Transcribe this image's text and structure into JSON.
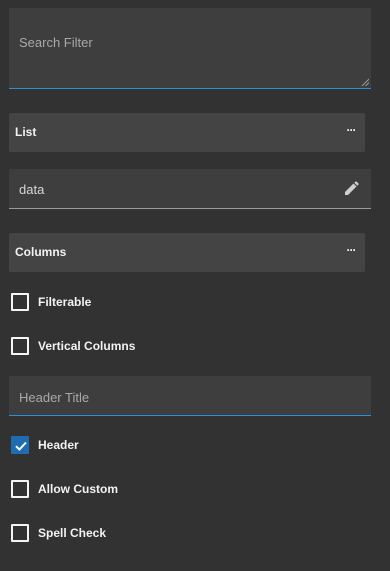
{
  "search_filter": {
    "placeholder": "Search Filter"
  },
  "list_section": {
    "label": "List",
    "more_icon": "ellipsis-icon",
    "more_glyph": "···"
  },
  "data_field": {
    "value": "data",
    "icon": "pencil-icon"
  },
  "columns_section": {
    "label": "Columns",
    "more_icon": "ellipsis-icon",
    "more_glyph": "···"
  },
  "checkboxes": {
    "filterable": {
      "label": "Filterable",
      "checked": false
    },
    "vertical_columns": {
      "label": "Vertical Columns",
      "checked": false
    },
    "header": {
      "label": "Header",
      "checked": true
    },
    "allow_custom": {
      "label": "Allow Custom",
      "checked": false
    },
    "spell_check": {
      "label": "Spell Check",
      "checked": false
    }
  },
  "header_title_field": {
    "placeholder": "Header Title"
  },
  "colors": {
    "background": "#323232",
    "field": "#3e3e3e",
    "section": "#444444",
    "accent": "#2f8fd6",
    "checked": "#1f6db0"
  }
}
